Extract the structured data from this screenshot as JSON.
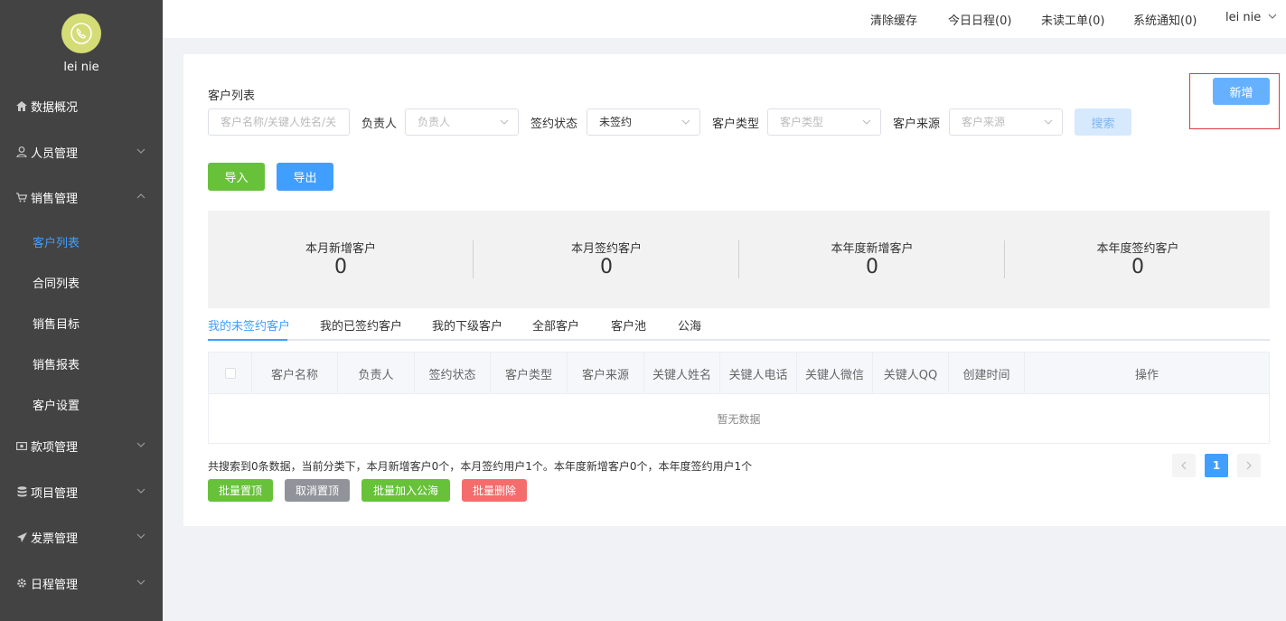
{
  "user": {
    "name": "lei nie"
  },
  "sidebar": {
    "items": [
      {
        "label": "数据概况",
        "icon": "home-icon"
      },
      {
        "label": "人员管理",
        "icon": "user-icon"
      },
      {
        "label": "销售管理",
        "icon": "cart-icon"
      },
      {
        "label": "款项管理",
        "icon": "money-icon"
      },
      {
        "label": "项目管理",
        "icon": "database-icon"
      },
      {
        "label": "发票管理",
        "icon": "send-icon"
      },
      {
        "label": "日程管理",
        "icon": "gear-icon"
      }
    ],
    "sub_items": [
      "客户列表",
      "合同列表",
      "销售目标",
      "销售报表",
      "客户设置"
    ]
  },
  "topbar": {
    "clear_cache": "清除缓存",
    "today_schedule": "今日日程(0)",
    "unread_tickets": "未读工单(0)",
    "notifications": "系统通知(0)",
    "user_menu": "lei nie"
  },
  "page": {
    "title": "客户列表"
  },
  "filters": {
    "search_placeholder": "客户名称/关键人姓名/关",
    "owner_label": "负责人",
    "owner_placeholder": "负责人",
    "sign_status_label": "签约状态",
    "sign_status_value": "未签约",
    "type_label": "客户类型",
    "type_placeholder": "客户类型",
    "source_label": "客户来源",
    "source_placeholder": "客户来源",
    "search_button": "搜索"
  },
  "actions": {
    "new": "新增",
    "import": "导入",
    "export": "导出"
  },
  "stats": [
    {
      "label": "本月新增客户",
      "value": "0"
    },
    {
      "label": "本月签约客户",
      "value": "0"
    },
    {
      "label": "本年度新增客户",
      "value": "0"
    },
    {
      "label": "本年度签约客户",
      "value": "0"
    }
  ],
  "tabs": [
    "我的未签约客户",
    "我的已签约客户",
    "我的下级客户",
    "全部客户",
    "客户池",
    "公海"
  ],
  "table": {
    "columns": [
      "客户名称",
      "负责人",
      "签约状态",
      "客户类型",
      "客户来源",
      "关键人姓名",
      "关键人电话",
      "关键人微信",
      "关键人QQ",
      "创建时间",
      "操作"
    ],
    "empty_text": "暂无数据"
  },
  "summary": "共搜索到0条数据，当前分类下，本月新增客户0个，本月签约用户1个。本年度新增客户0个，本年度签约用户1个",
  "bulk_actions": {
    "pin": "批量置顶",
    "unpin": "取消置顶",
    "to_public": "批量加入公海",
    "delete": "批量删除"
  },
  "pagination": {
    "current": "1"
  },
  "colors": {
    "accent": "#409eff",
    "green": "#67c23a",
    "red": "#f56c6c",
    "sidebar": "#434343"
  }
}
